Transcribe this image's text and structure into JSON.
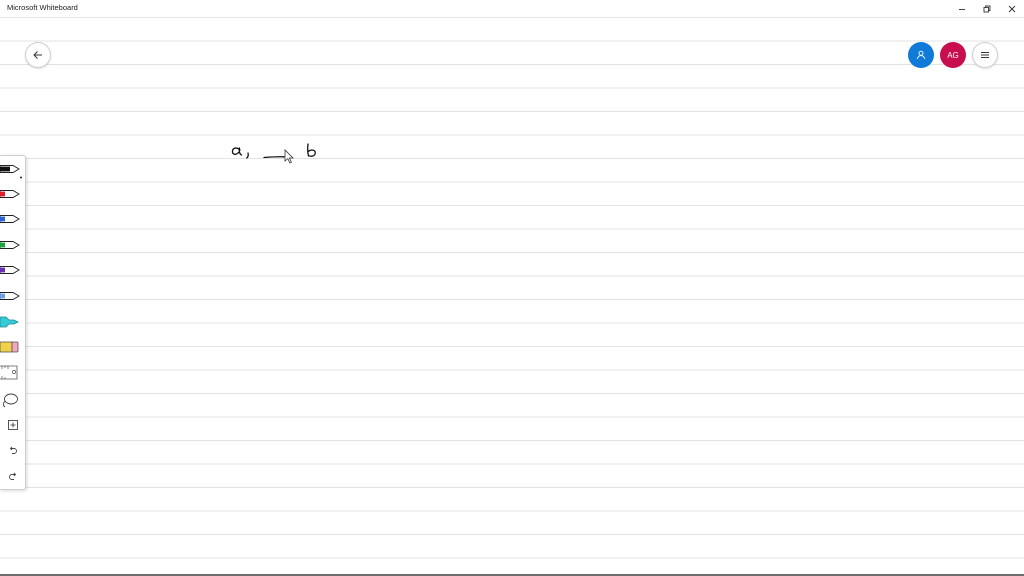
{
  "window": {
    "title": "Microsoft Whiteboard",
    "controls": [
      "minimize-icon",
      "restore-icon",
      "close-icon"
    ]
  },
  "header": {
    "back_icon": "arrow-left-icon",
    "share_icon": "person-icon",
    "avatar_initials": "AG",
    "menu_icon": "hamburger-icon"
  },
  "toolbar": {
    "tools": [
      {
        "name": "black-pen",
        "color": "#111111",
        "selected": true
      },
      {
        "name": "red-pen",
        "color": "#e0202a"
      },
      {
        "name": "blue-pen",
        "color": "#2a63d6"
      },
      {
        "name": "green-pen",
        "color": "#19a53a"
      },
      {
        "name": "purple-pen",
        "color": "#6a2fb5"
      },
      {
        "name": "light-blue-pen",
        "color": "#6fa0e8"
      },
      {
        "name": "highlighter",
        "color": "#36c9d6"
      },
      {
        "name": "eraser",
        "color": "#f0d24a"
      },
      {
        "name": "ruler",
        "color": "#555555"
      },
      {
        "name": "lasso",
        "color": "#555555"
      },
      {
        "name": "add",
        "icon": "plus-square-icon"
      },
      {
        "name": "undo",
        "icon": "undo-icon"
      },
      {
        "name": "redo",
        "icon": "redo-icon"
      }
    ]
  },
  "canvas": {
    "ink_strokes": [
      "a,",
      "b"
    ],
    "ink_color": "#111111"
  }
}
